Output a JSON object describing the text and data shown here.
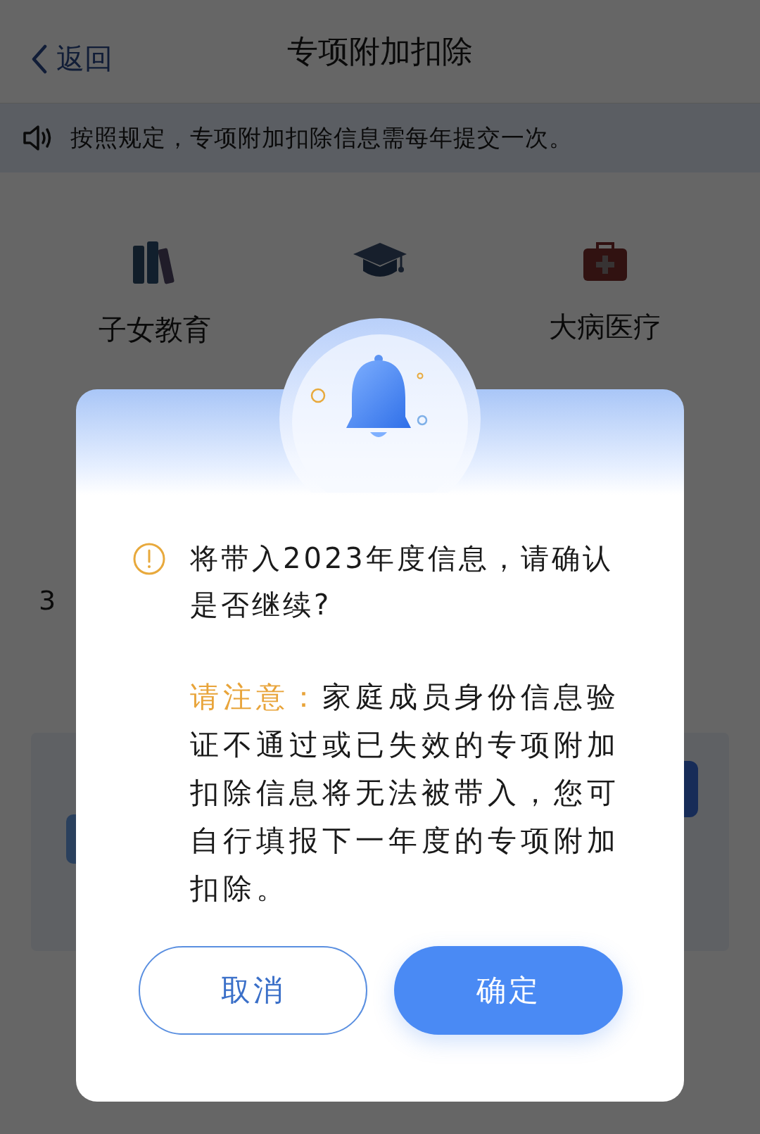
{
  "header": {
    "back": "返回",
    "title": "专项附加扣除"
  },
  "notice": {
    "text": "按照规定，专项附加扣除信息需每年提交一次。"
  },
  "categories": [
    {
      "kind": "books",
      "label": "子女教育"
    },
    {
      "kind": "cap"
    },
    {
      "kind": "medkit",
      "label": "大病医疗"
    }
  ],
  "background_texts": [
    "3"
  ],
  "dialog": {
    "message": "将带入2023年度信息，请确认是否继续?",
    "note": {
      "label": "请注意：",
      "text": "家庭成员身份信息验证不通过或已失效的专项附加扣除信息将无法被带入，您可自行填报下一年度的专项附加扣除。"
    },
    "buttons": [
      {
        "kind": "secondary",
        "label": "取消"
      },
      {
        "kind": "primary",
        "label": "确定"
      }
    ]
  }
}
